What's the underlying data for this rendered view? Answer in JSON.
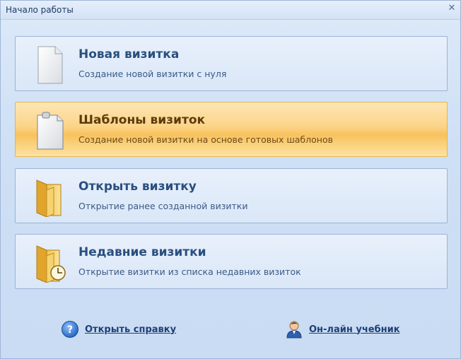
{
  "window": {
    "title": "Начало работы"
  },
  "items": [
    {
      "title": "Новая визитка",
      "subtitle": "Создание новой визитки с нуля",
      "icon": "blank-page-icon",
      "selected": false
    },
    {
      "title": "Шаблоны визиток",
      "subtitle": "Создание новой визитки на основе готовых шаблонов",
      "icon": "template-page-icon",
      "selected": true
    },
    {
      "title": "Открыть визитку",
      "subtitle": "Открытие ранее созданной визитки",
      "icon": "folder-icon",
      "selected": false
    },
    {
      "title": "Недавние визитки",
      "subtitle": "Открытие визитки из списка недавних визиток",
      "icon": "recent-folder-icon",
      "selected": false
    }
  ],
  "links": {
    "help": {
      "label": "Открыть справку",
      "icon": "help-icon"
    },
    "tutorial": {
      "label": "Он-лайн учебник",
      "icon": "user-icon"
    }
  },
  "colors": {
    "accent": "#f8c25e",
    "title_text": "#2a4f7f",
    "link_text": "#1d3f78"
  }
}
